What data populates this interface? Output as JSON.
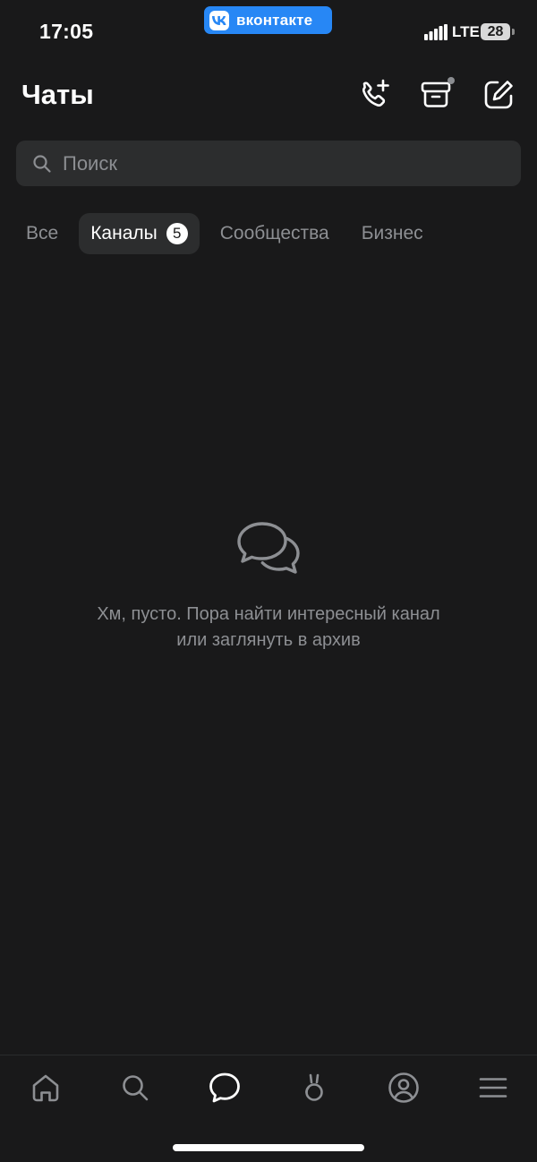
{
  "status_bar": {
    "time": "17:05",
    "app_pill": "вконтакте",
    "network": "LTE",
    "battery": "28"
  },
  "header": {
    "title": "Чаты",
    "icons": [
      "phone-plus-icon",
      "archive-icon",
      "compose-icon"
    ]
  },
  "search": {
    "placeholder": "Поиск",
    "value": ""
  },
  "tabs": [
    {
      "label": "Все",
      "active": false
    },
    {
      "label": "Каналы",
      "active": true,
      "badge": "5"
    },
    {
      "label": "Сообщества",
      "active": false
    },
    {
      "label": "Бизнес",
      "active": false
    }
  ],
  "empty_state": {
    "icon": "chat-bubbles-icon",
    "line1": "Хм, пусто. Пора найти интересный канал",
    "line2": "или заглянуть в архив"
  },
  "bottom_nav": {
    "items": [
      "home-icon",
      "search-icon",
      "messages-icon",
      "clips-icon",
      "profile-icon",
      "menu-icon"
    ],
    "active": "messages-icon"
  },
  "colors": {
    "background": "#19191a",
    "surface": "#2c2d2e",
    "secondary_text": "#8d8f93",
    "vk_blue": "#2787f5"
  }
}
